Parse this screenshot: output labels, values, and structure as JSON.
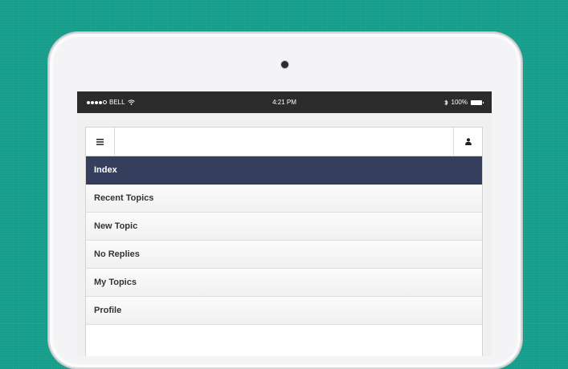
{
  "statusbar": {
    "carrier": "BELL",
    "time": "4:21 PM",
    "battery": "100%",
    "signal_bars": 4
  },
  "icons": {
    "menu": "hamburger-icon",
    "user": "user-icon",
    "wifi": "wifi-icon",
    "bluetooth": "bluetooth-icon",
    "battery": "battery-icon"
  },
  "colors": {
    "background": "#17a08d",
    "active_nav": "#353e5c",
    "status_bar": "#2b2b2b"
  },
  "nav": {
    "items": [
      {
        "label": "Index",
        "active": true
      },
      {
        "label": "Recent Topics",
        "active": false
      },
      {
        "label": "New Topic",
        "active": false
      },
      {
        "label": "No Replies",
        "active": false
      },
      {
        "label": "My Topics",
        "active": false
      },
      {
        "label": "Profile",
        "active": false
      }
    ]
  }
}
